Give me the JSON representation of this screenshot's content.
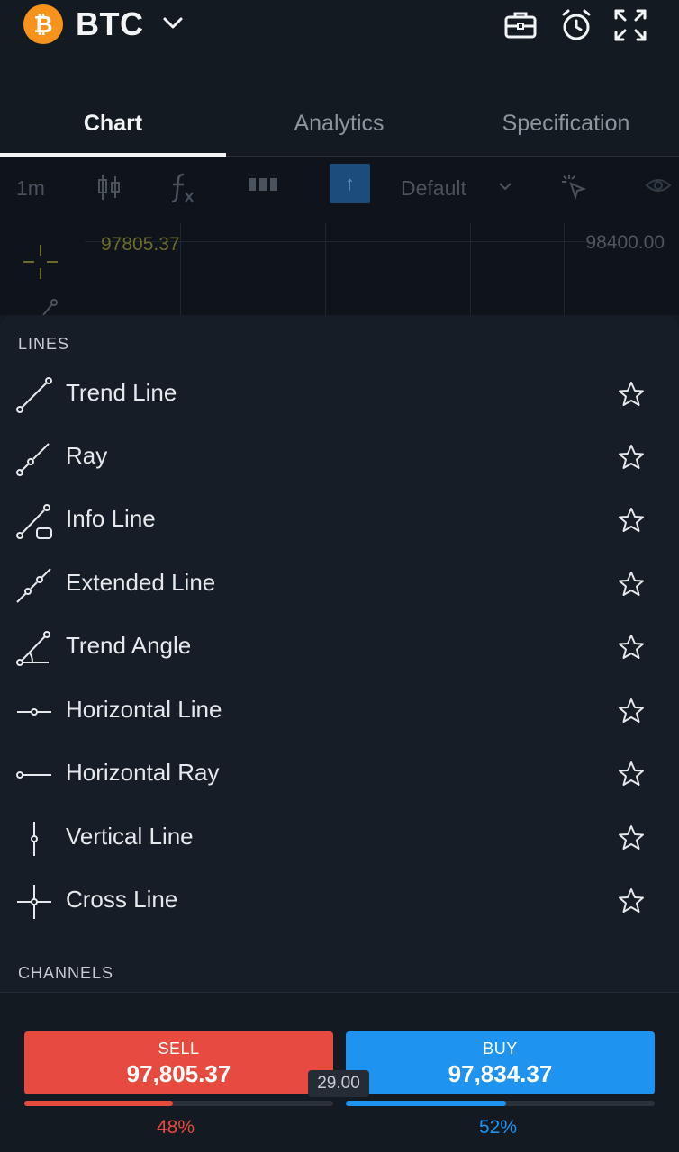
{
  "header": {
    "coin_glyph": "₿",
    "symbol": "BTC",
    "icons": [
      "briefcase-icon",
      "alarm-icon",
      "fullscreen-icon"
    ]
  },
  "tabs": [
    {
      "label": "Chart",
      "active": true
    },
    {
      "label": "Analytics",
      "active": false
    },
    {
      "label": "Specification",
      "active": false
    }
  ],
  "toolbar": {
    "interval": "1m",
    "chart_type_icon": "candlestick-icon",
    "indicators_icon": "function-icon",
    "layout_icon": "bars-icon",
    "up_icon": "arrow-up-icon",
    "template": "Default",
    "cursor_icon": "cursor-icon",
    "visibility_icon": "eye-icon"
  },
  "chart": {
    "price_left": "97805.37",
    "price_right": "98400.00"
  },
  "panel": {
    "sections": [
      {
        "title": "LINES",
        "items": [
          {
            "label": "Trend Line",
            "icon": "trend-line-icon"
          },
          {
            "label": "Ray",
            "icon": "ray-icon"
          },
          {
            "label": "Info Line",
            "icon": "info-line-icon"
          },
          {
            "label": "Extended Line",
            "icon": "extended-line-icon"
          },
          {
            "label": "Trend Angle",
            "icon": "trend-angle-icon"
          },
          {
            "label": "Horizontal Line",
            "icon": "horizontal-line-icon"
          },
          {
            "label": "Horizontal Ray",
            "icon": "horizontal-ray-icon"
          },
          {
            "label": "Vertical Line",
            "icon": "vertical-line-icon"
          },
          {
            "label": "Cross Line",
            "icon": "cross-line-icon"
          }
        ]
      },
      {
        "title": "CHANNELS",
        "items": []
      }
    ]
  },
  "trade": {
    "sell": {
      "label": "SELL",
      "price": "97,805.37",
      "percent": "48%",
      "fraction": 0.48,
      "color": "#e74b3f"
    },
    "buy": {
      "label": "BUY",
      "price": "97,834.37",
      "percent": "52%",
      "fraction": 0.52,
      "color": "#1e93f0"
    },
    "spread": "29.00"
  }
}
